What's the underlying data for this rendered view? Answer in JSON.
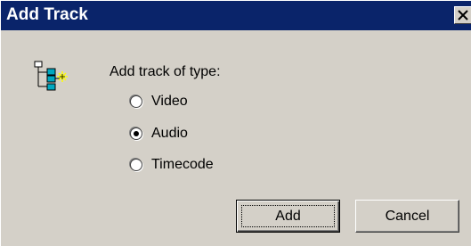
{
  "window": {
    "title": "Add Track",
    "close_icon": "close-icon"
  },
  "dialog": {
    "icon": "track-tree-icon",
    "group_label": "Add track of type:",
    "options": [
      {
        "label": "Video",
        "checked": false
      },
      {
        "label": "Audio",
        "checked": true
      },
      {
        "label": "Timecode",
        "checked": false
      }
    ]
  },
  "buttons": {
    "add_label": "Add",
    "cancel_label": "Cancel"
  },
  "colors": {
    "titlebar": "#0a246a",
    "face": "#d4d0c8",
    "icon_accent": "#00a8c0"
  }
}
